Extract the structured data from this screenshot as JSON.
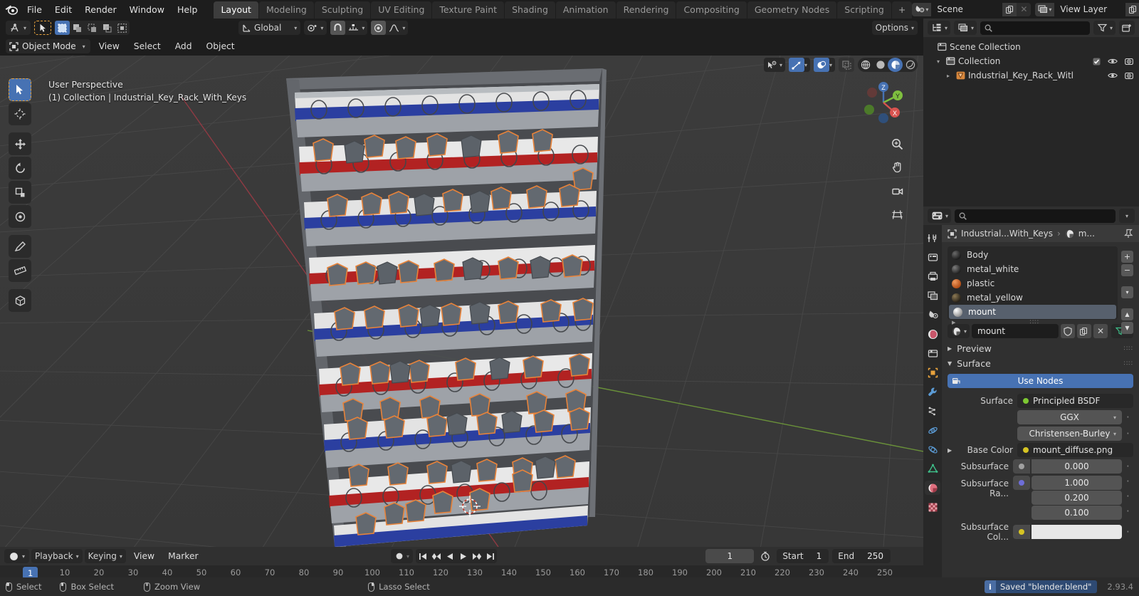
{
  "app": {
    "version": "2.93.4",
    "logo_icon": "blender-logo"
  },
  "topbar": {
    "menus": [
      "File",
      "Edit",
      "Render",
      "Window",
      "Help"
    ],
    "workspace_tabs": [
      "Layout",
      "Modeling",
      "Sculpting",
      "UV Editing",
      "Texture Paint",
      "Shading",
      "Animation",
      "Rendering",
      "Compositing",
      "Geometry Nodes",
      "Scripting"
    ],
    "active_workspace": "Layout",
    "add_workspace_label": "+",
    "scene": {
      "icon": "scene-icon",
      "name": "Scene",
      "new_icon": "duplicate-icon",
      "unlink_icon": "close-icon"
    },
    "view_layer": {
      "icon": "view-layer-icon",
      "name": "View Layer",
      "new_icon": "duplicate-icon",
      "unlink_icon": "close-icon"
    }
  },
  "viewport": {
    "editor_type_icon": "editor-type-icon",
    "cursor_tool_icon": "tweak-cursor-icon",
    "select_modes": [
      "set-select-icon",
      "extend-select-icon",
      "subtract-select-icon",
      "intersect-select-icon",
      "difference-select-icon"
    ],
    "mode": "Object Mode",
    "mode_icon": "object-mode-icon",
    "menus": [
      "View",
      "Select",
      "Add",
      "Object"
    ],
    "transform_orientation": {
      "icon": "orientation-icon",
      "value": "Global"
    },
    "pivot_icon": "pivot-point-icon",
    "snap_magnet_icon": "magnet-icon",
    "snap_icon": "snap-increment-icon",
    "proportional_icon": "proportional-edit-icon",
    "falloff_icon": "smooth-falloff-icon",
    "options_label": "Options",
    "visibility_icon": "show-hide-icon",
    "gizmo_icon": "gizmo-icon",
    "overlays_icon": "overlays-icon",
    "xray_icon": "xray-icon",
    "shading_modes": [
      "wireframe-icon",
      "solid-icon",
      "material-preview-icon",
      "rendered-icon"
    ],
    "active_shading": "material-preview-icon",
    "overlay": {
      "line1": "User Perspective",
      "line2": "(1) Collection | Industrial_Key_Rack_With_Keys"
    },
    "tools": [
      {
        "name": "tweak-tool",
        "icon": "cursor-arrow-icon",
        "active": true
      },
      {
        "name": "cursor-tool",
        "icon": "3d-cursor-icon",
        "active": false
      },
      {
        "name": "move-tool",
        "icon": "move-icon",
        "active": false
      },
      {
        "name": "rotate-tool",
        "icon": "rotate-icon",
        "active": false
      },
      {
        "name": "scale-tool",
        "icon": "scale-icon",
        "active": false
      },
      {
        "name": "transform-tool",
        "icon": "transform-icon",
        "active": false
      },
      {
        "name": "annotate-tool",
        "icon": "pencil-icon",
        "active": false
      },
      {
        "name": "measure-tool",
        "icon": "ruler-icon",
        "active": false
      },
      {
        "name": "add-cube-tool",
        "icon": "add-cube-icon",
        "active": false
      }
    ],
    "nav_buttons": [
      "zoom-icon",
      "pan-icon",
      "camera-icon",
      "ortho-persp-icon"
    ],
    "gizmo_axes": [
      {
        "label": "Z",
        "color": "#4772b3"
      },
      {
        "label": "Y",
        "color": "#7fbf3f"
      },
      {
        "label": "X",
        "color": "#d9534f"
      }
    ]
  },
  "timeline": {
    "editor_icon": "timeline-editor-icon",
    "menus": [
      "Playback",
      "Keying",
      "View",
      "Marker"
    ],
    "keying_set_icon": "record-icon",
    "transport": [
      "jump-start-icon",
      "prev-keyframe-icon",
      "play-reverse-icon",
      "play-icon",
      "next-keyframe-icon",
      "jump-end-icon"
    ],
    "current_frame": "1",
    "auto_key_icon": "stopwatch-icon",
    "start_label": "Start",
    "start_value": "1",
    "end_label": "End",
    "end_value": "250",
    "ruler_ticks": [
      "10",
      "20",
      "30",
      "40",
      "50",
      "60",
      "70",
      "80",
      "90",
      "100",
      "110",
      "120",
      "130",
      "140",
      "150",
      "160",
      "170",
      "180",
      "190",
      "200",
      "210",
      "220",
      "230",
      "240",
      "250"
    ],
    "playhead_label": "1"
  },
  "outliner": {
    "display_mode_icon": "outliner-display-icon",
    "filter_id_icon": "view-layer-icon",
    "search_placeholder": "",
    "search_icon": "search-icon",
    "filter_icon": "filter-icon",
    "new_collection_icon": "new-collection-icon",
    "rows": [
      {
        "label": "Scene Collection",
        "icon": "collection-icon",
        "depth": 0,
        "twisty": "",
        "checkbox": false,
        "eye": false,
        "camera": false
      },
      {
        "label": "Collection",
        "icon": "collection-icon",
        "depth": 1,
        "twisty": "▾",
        "checkbox": true,
        "eye": true,
        "camera": true
      },
      {
        "label": "Industrial_Key_Rack_Witl",
        "icon": "mesh-object-icon",
        "depth": 2,
        "twisty": "▸",
        "checkbox": false,
        "eye": true,
        "camera": true
      }
    ]
  },
  "properties": {
    "editor_icon": "properties-editor-icon",
    "search_placeholder": "",
    "search_icon": "search-icon",
    "dropdown_icon": "chevron-down-icon",
    "tabs": [
      {
        "name": "tool",
        "icon": "tool-icon",
        "active": false
      },
      {
        "name": "render",
        "icon": "render-icon",
        "active": false
      },
      {
        "name": "output",
        "icon": "output-icon",
        "active": false
      },
      {
        "name": "view-layer",
        "icon": "view-layer-icon",
        "active": false
      },
      {
        "name": "scene",
        "icon": "scene-icon",
        "active": false
      },
      {
        "name": "world",
        "icon": "world-icon",
        "active": false
      },
      {
        "name": "collection",
        "icon": "collection-properties-icon",
        "active": false
      },
      {
        "name": "object",
        "icon": "object-properties-icon",
        "active": false
      },
      {
        "name": "modifiers",
        "icon": "wrench-icon",
        "active": false
      },
      {
        "name": "particles",
        "icon": "particles-icon",
        "active": false
      },
      {
        "name": "physics",
        "icon": "physics-icon",
        "active": false
      },
      {
        "name": "constraints",
        "icon": "constraints-icon",
        "active": false
      },
      {
        "name": "object-data",
        "icon": "mesh-data-icon",
        "active": false
      },
      {
        "name": "material",
        "icon": "material-icon",
        "active": true
      },
      {
        "name": "texture",
        "icon": "texture-icon",
        "active": false
      }
    ],
    "breadcrumb": {
      "object_icon": "object-icon",
      "object": "Industrial...With_Keys",
      "sep": "›",
      "material_icon": "material-icon",
      "material": "m...",
      "pin_icon": "pin-icon"
    },
    "material_slots": [
      {
        "name": "Body",
        "color": "#2b2b2b"
      },
      {
        "name": "metal_white",
        "color": "#3a3a3a"
      },
      {
        "name": "plastic",
        "color": "#d2642a"
      },
      {
        "name": "metal_yellow",
        "color": "#4a3f30"
      },
      {
        "name": "mount",
        "color": "#dcdcdc"
      }
    ],
    "selected_slot": "mount",
    "slot_buttons": [
      "add-icon",
      "remove-icon",
      "specials-icon",
      "move-up-icon",
      "move-down-icon"
    ],
    "material_datablock": {
      "icon": "material-icon",
      "name": "mount",
      "shield_icon": "fake-user-icon",
      "copy_icon": "new-material-icon",
      "unlink_icon": "close-icon",
      "browse_icon": "browse-material-icon"
    },
    "panels": [
      {
        "label": "Preview",
        "expanded": false
      },
      {
        "label": "Surface",
        "expanded": true
      }
    ],
    "use_nodes_label": "Use Nodes",
    "use_nodes_icon": "nodetree-icon",
    "surface": {
      "label": "Surface",
      "shader": "Principled BSDF",
      "shader_dot": "#7dc832",
      "distribution": "GGX",
      "subsurface_method": "Christensen-Burley",
      "base_color_label": "Base Color",
      "base_color_value": "mount_diffuse.png",
      "base_color_dot": "#d6c423",
      "subsurface_label": "Subsurface",
      "subsurface_value": "0.000",
      "subsurface_dot": "#a0a0a0",
      "subsurface_radius_label": "Subsurface Ra...",
      "subsurface_radius_dot": "#6e6ed8",
      "subsurface_radius_values": [
        "1.000",
        "0.200",
        "0.100"
      ],
      "subsurface_color_label": "Subsurface Col...",
      "subsurface_color_dot": "#d6c423",
      "subsurface_color_swatch": "#e8e8e8"
    }
  },
  "status_bar": {
    "hints": [
      {
        "icon": "mouse-left-icon",
        "label": "Select"
      },
      {
        "icon": "mouse-left-drag-icon",
        "label": "Box Select"
      },
      {
        "icon": "mouse-middle-icon",
        "label": "Zoom View"
      },
      {
        "icon": "mouse-right-icon",
        "label": "Lasso Select"
      }
    ],
    "report": {
      "icon": "info-icon",
      "text": "Saved \"blender.blend\""
    },
    "version": "2.93.4"
  }
}
